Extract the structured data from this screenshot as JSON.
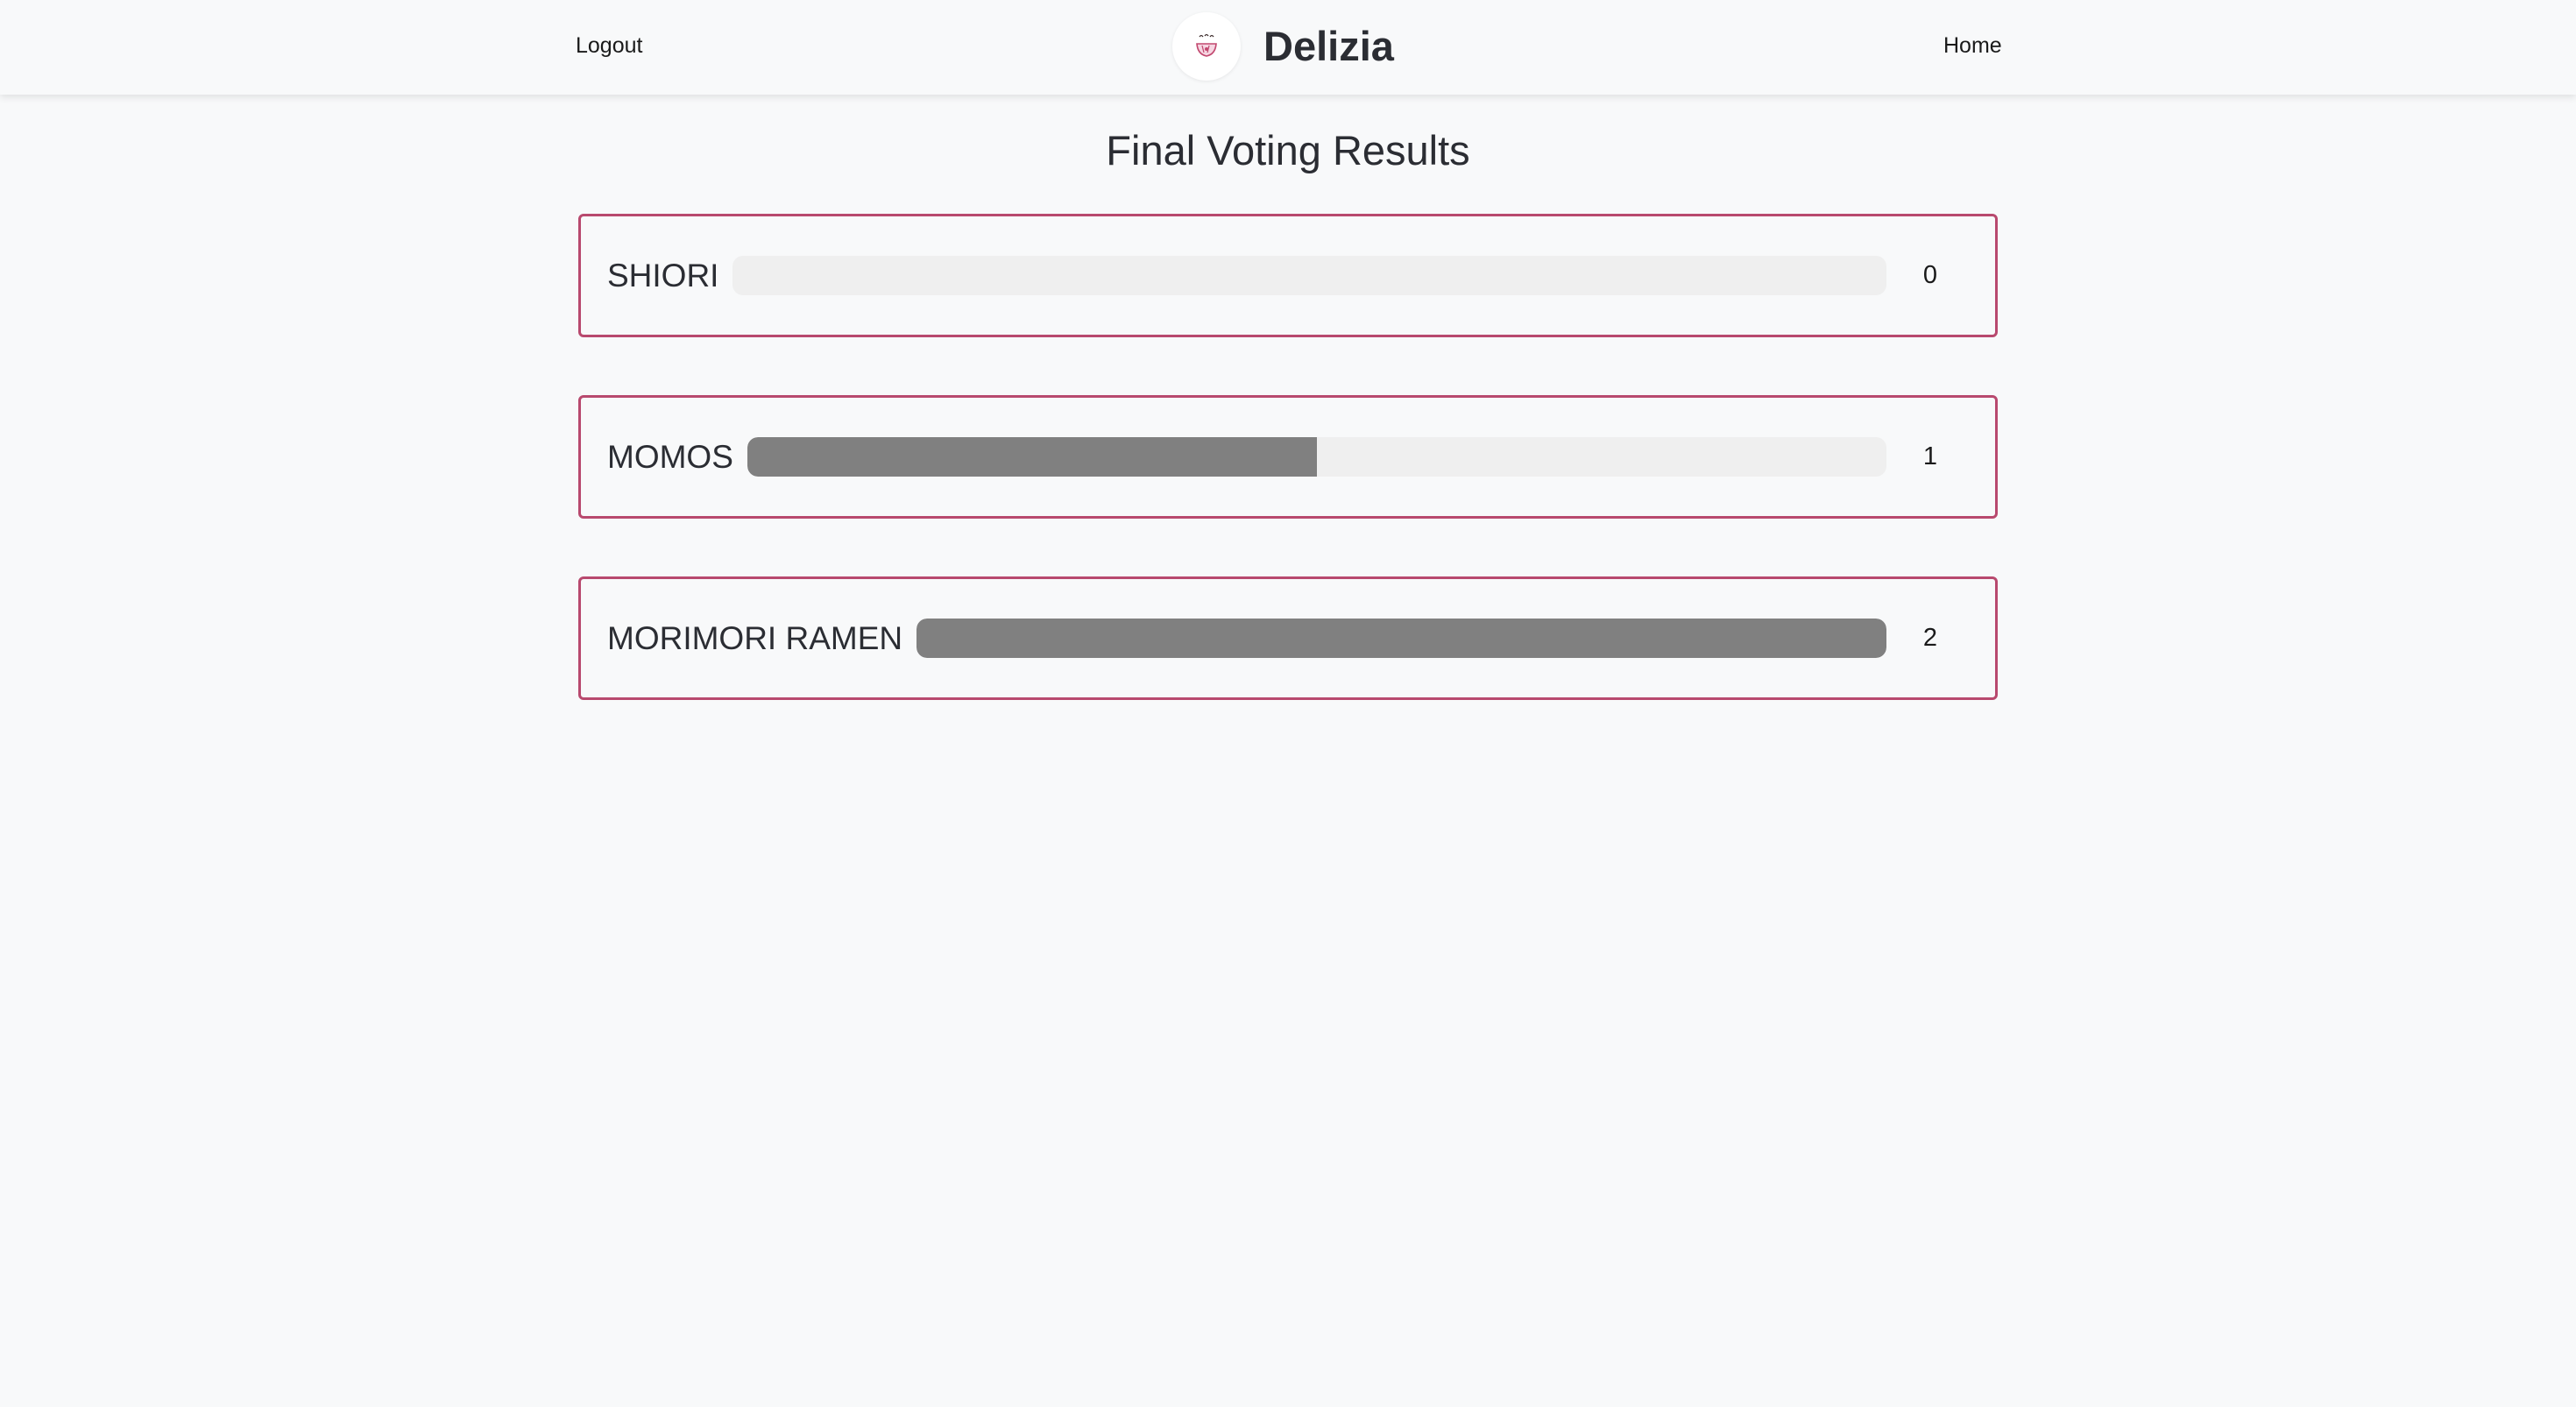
{
  "nav": {
    "logout_label": "Logout",
    "home_label": "Home",
    "brand_name": "Delizia",
    "logo_icon": "ramen-bowl-logo-icon"
  },
  "page": {
    "title": "Final Voting Results"
  },
  "results": [
    {
      "name": "SHIORI",
      "votes": "0",
      "fraction": 0
    },
    {
      "name": "MOMOS",
      "votes": "1",
      "fraction": 0.5
    },
    {
      "name": "MORIMORI RAMEN",
      "votes": "2",
      "fraction": 1
    }
  ],
  "colors": {
    "card_border": "#b8496e",
    "bar_fill": "#808080",
    "bar_track": "#efefef",
    "background": "#f8f9fa"
  }
}
